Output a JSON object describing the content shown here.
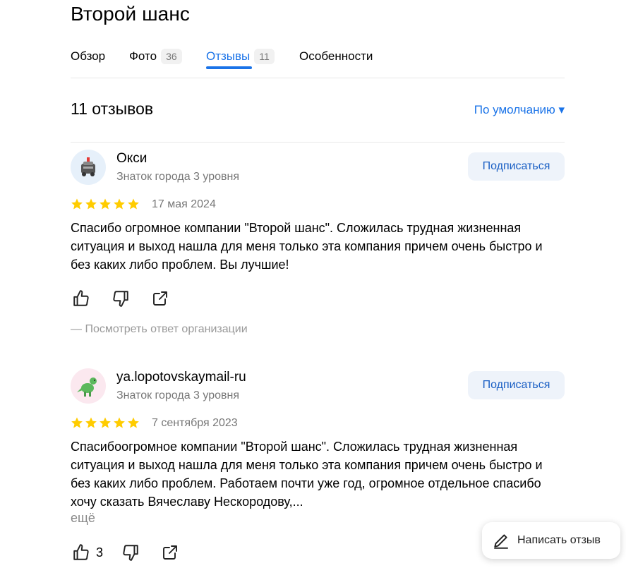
{
  "title": "Второй шанс",
  "tabs": [
    {
      "label": "Обзор",
      "count": ""
    },
    {
      "label": "Фото",
      "count": "36"
    },
    {
      "label": "Отзывы",
      "count": "11"
    },
    {
      "label": "Особенности",
      "count": ""
    }
  ],
  "reviews_header": {
    "count_label": "11 отзывов",
    "sort_label": "По умолчанию ▾"
  },
  "reviews": [
    {
      "author": "Окси",
      "level": "Знаток города 3 уровня",
      "subscribe_label": "Подписаться",
      "rating": 5,
      "date": "17 мая 2024",
      "text": "Спасибо огромное компании \"Второй шанс\". Сложилась трудная жизненная ситуация и выход нашла для меня только эта компания причем очень быстро и без каких либо проблем. Вы лучшие!",
      "answer_link": "— Посмотреть ответ организации"
    },
    {
      "author": "ya.lopotovskaymail-ru",
      "level": "Знаток города 3 уровня",
      "subscribe_label": "Подписаться",
      "rating": 5,
      "date": "7 сентября 2023",
      "text": "Спасибоогромное компании \"Второй шанс\". Сложилась трудная жизненная ситуация и выход нашла для меня только эта компания причем очень быстро и без каких либо проблем. Работаем почти уже год, огромное отдельное спасибо хочу сказать Вячеславу Нескородову,...",
      "more_label": "ещё",
      "likes": "3"
    }
  ],
  "write_review_label": "Написать отзыв",
  "colors": {
    "accent": "#1a73e8",
    "star": "#ffcc00",
    "muted": "#777777"
  }
}
